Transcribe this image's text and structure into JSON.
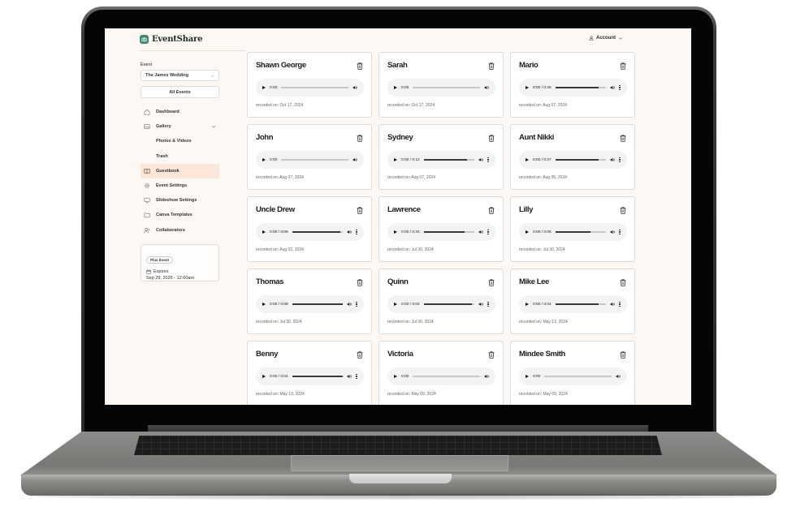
{
  "app": {
    "name": "EventShare"
  },
  "header": {
    "account_label": "Account"
  },
  "sidebar": {
    "event_label": "Event",
    "event_selected": "The James Wedding",
    "all_events_label": "All Events",
    "nav": [
      {
        "label": "Dashboard",
        "icon": "home-icon"
      },
      {
        "label": "Gallery",
        "icon": "image-icon",
        "expanded": true
      },
      {
        "label": "Photos & Videos",
        "sub": true
      },
      {
        "label": "Trash",
        "sub": true
      },
      {
        "label": "Guestbook",
        "icon": "book-icon",
        "active": true
      },
      {
        "label": "Event Settings",
        "icon": "gear-icon"
      },
      {
        "label": "Slideshow Settings",
        "icon": "monitor-icon"
      },
      {
        "label": "Canva Templates",
        "icon": "folder-icon"
      },
      {
        "label": "Collaborators",
        "icon": "user-plus-icon"
      }
    ],
    "plan": {
      "badge": "Plus Event",
      "expires_label": "Expires",
      "expires_date": "Sep 29, 2025 - 12:00am"
    }
  },
  "recordings": [
    {
      "name": "Shawn George",
      "time": "0:00",
      "duration": null,
      "played": 0,
      "recorded": "recorded on: Oct 17, 2024"
    },
    {
      "name": "Sarah",
      "time": "0:00",
      "duration": null,
      "played": 0,
      "recorded": "recorded on: Oct 17, 2024"
    },
    {
      "name": "Mario",
      "time": "0:00 / 0:26",
      "duration": "0:26",
      "played": 0.85,
      "recorded": "recorded on: Aug 07, 2024"
    },
    {
      "name": "John",
      "time": "0:00",
      "duration": null,
      "played": 0,
      "recorded": "recorded on: Aug 07, 2024"
    },
    {
      "name": "Sydney",
      "time": "0:00 / 0:12",
      "duration": "0:12",
      "played": 0.85,
      "recorded": "recorded on: Aug 07, 2024"
    },
    {
      "name": "Aunt Nikki",
      "time": "0:00 / 0:27",
      "duration": "0:27",
      "played": 0.85,
      "recorded": "recorded on: Aug 05, 2024"
    },
    {
      "name": "Uncle Drew",
      "time": "0:00 / 0:06",
      "duration": "0:06",
      "played": 0.95,
      "recorded": "recorded on: Aug 02, 2024"
    },
    {
      "name": "Lawrence",
      "time": "0:00 / 0:34",
      "duration": "0:34",
      "played": 0.8,
      "recorded": "recorded on: Jul 30, 2024"
    },
    {
      "name": "Lilly",
      "time": "0:00 / 0:05",
      "duration": "0:05",
      "played": 0.7,
      "recorded": "recorded on: Jul 30, 2024"
    },
    {
      "name": "Thomas",
      "time": "0:00 / 0:08",
      "duration": "0:08",
      "played": 1.0,
      "recorded": "recorded on: Jul 30, 2024"
    },
    {
      "name": "Quinn",
      "time": "0:00 / 0:04",
      "duration": "0:04",
      "played": 0.95,
      "recorded": "recorded on: Jul 30, 2024"
    },
    {
      "name": "Mike Lee",
      "time": "0:00 / 0:04",
      "duration": "0:04",
      "played": 0.85,
      "recorded": "recorded on: May 13, 2024"
    },
    {
      "name": "Benny",
      "time": "0:00 / 0:04",
      "duration": "0:04",
      "played": 1.0,
      "recorded": "recorded on: May 13, 2024"
    },
    {
      "name": "Victoria",
      "time": "0:00",
      "duration": null,
      "played": 0,
      "recorded": "recorded on: May 09, 2024"
    },
    {
      "name": "Mindee Smith",
      "time": "0:00",
      "duration": null,
      "played": 0,
      "recorded": "recorded on: May 09, 2024"
    }
  ],
  "colors": {
    "brand": "#3d8a74",
    "active_nav_bg": "#fbe6d8",
    "page_bg": "#fdf8f3"
  }
}
